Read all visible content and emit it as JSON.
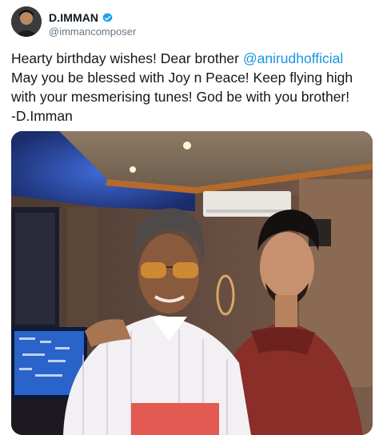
{
  "tweet": {
    "author": {
      "display_name": "D.IMMAN",
      "handle": "@immancomposer",
      "verified": true
    },
    "text": {
      "line1_prefix": "Hearty birthday wishes! Dear brother ",
      "mention": "@anirudhofficial",
      "line2": "May you be blessed with Joy n Peace! Keep flying high",
      "line3": "with your mesmerising tunes! God be with you brother!",
      "line4": "-D.Imman"
    },
    "media": {
      "type": "photo"
    }
  },
  "colors": {
    "mention": "#1b95e0",
    "verified_badge": "#1da1f2",
    "handle": "#657786",
    "text": "#14171a"
  },
  "icons": {
    "verified": "verified-badge-icon"
  }
}
